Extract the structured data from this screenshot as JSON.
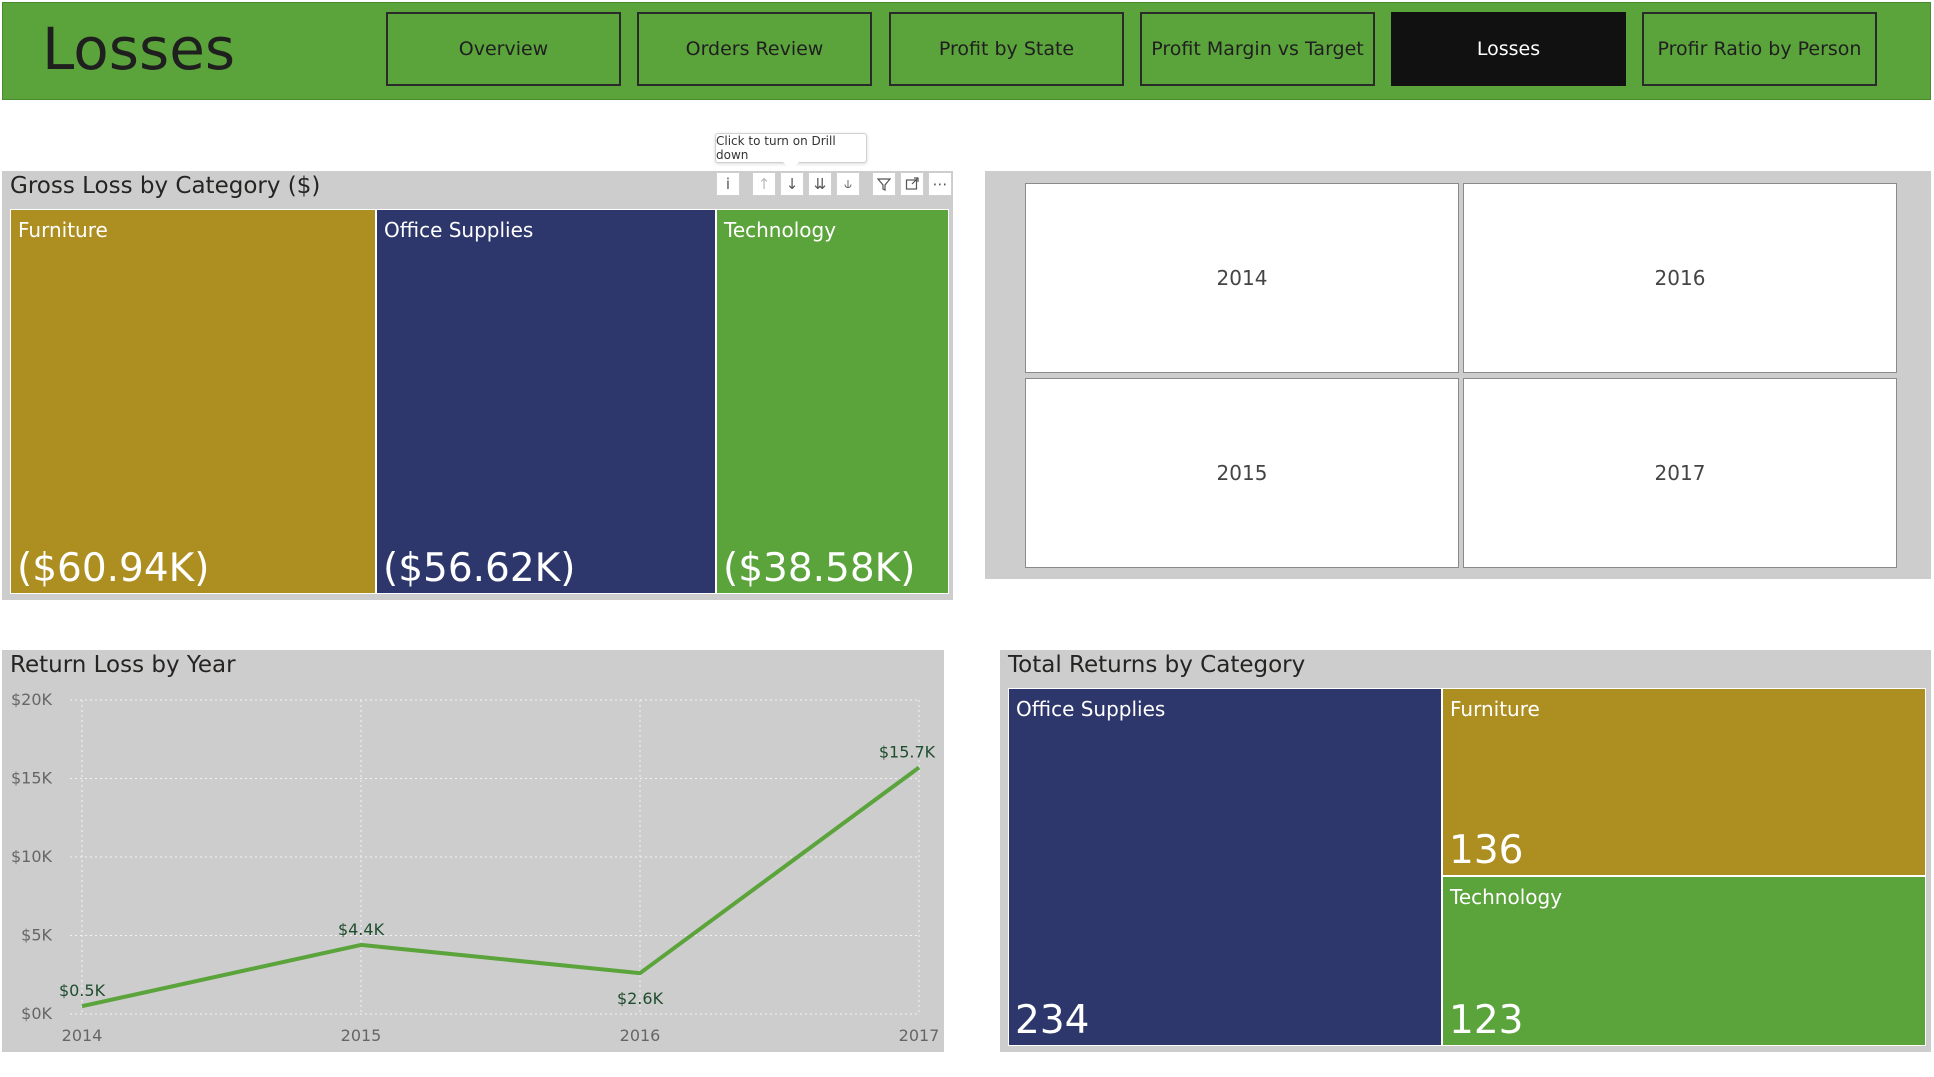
{
  "page": {
    "title": "Losses"
  },
  "nav": [
    {
      "label": "Overview",
      "active": false
    },
    {
      "label": "Orders Review",
      "active": false
    },
    {
      "label": "Profit by State",
      "active": false
    },
    {
      "label": "Profit Margin vs Target",
      "active": false
    },
    {
      "label": "Losses",
      "active": true
    },
    {
      "label": "Profir Ratio by Person",
      "active": false
    }
  ],
  "tooltip": {
    "text": "Click to turn on Drill down"
  },
  "visual_header_icons": [
    "info-icon",
    "drill-up-icon",
    "drill-down-icon",
    "expand-all-icon",
    "expand-hierarchy-icon",
    "filter-icon",
    "focus-mode-icon",
    "more-options-icon"
  ],
  "gross_loss": {
    "title": "Gross Loss by Category ($)",
    "tiles": [
      {
        "label": "Furniture",
        "value": "($60.94K)",
        "color": "#ad8e21"
      },
      {
        "label": "Office Supplies",
        "value": "($56.62K)",
        "color": "#2e376b"
      },
      {
        "label": "Technology",
        "value": "($38.58K)",
        "color": "#5ba33b"
      }
    ]
  },
  "year_slicer": {
    "years": [
      "2014",
      "2016",
      "2015",
      "2017"
    ]
  },
  "return_loss": {
    "title": "Return Loss by Year"
  },
  "total_returns": {
    "title": "Total Returns by Category",
    "tiles": [
      {
        "label": "Office Supplies",
        "value": "234",
        "color": "#2e376b"
      },
      {
        "label": "Furniture",
        "value": "136",
        "color": "#ad8e21"
      },
      {
        "label": "Technology",
        "value": "123",
        "color": "#5ba33b"
      }
    ]
  },
  "chart_data": [
    {
      "type": "treemap",
      "title": "Gross Loss by Category ($)",
      "categories": [
        "Furniture",
        "Office Supplies",
        "Technology"
      ],
      "values": [
        -60.94,
        -56.62,
        -38.58
      ],
      "value_labels": [
        "($60.94K)",
        "($56.62K)",
        "($38.58K)"
      ]
    },
    {
      "type": "line",
      "title": "Return Loss by Year",
      "x": [
        "2014",
        "2015",
        "2016",
        "2017"
      ],
      "y": [
        0.5,
        4.4,
        2.6,
        15.7
      ],
      "data_labels": [
        "$0.5K",
        "$4.4K",
        "$2.6K",
        "$15.7K"
      ],
      "yticks": [
        "$0K",
        "$5K",
        "$10K",
        "$15K",
        "$20K"
      ],
      "ylim": [
        0,
        20
      ],
      "grid": true,
      "line_color": "#5ba33b"
    },
    {
      "type": "treemap",
      "title": "Total Returns by Category",
      "categories": [
        "Office Supplies",
        "Furniture",
        "Technology"
      ],
      "values": [
        234,
        136,
        123
      ]
    }
  ]
}
